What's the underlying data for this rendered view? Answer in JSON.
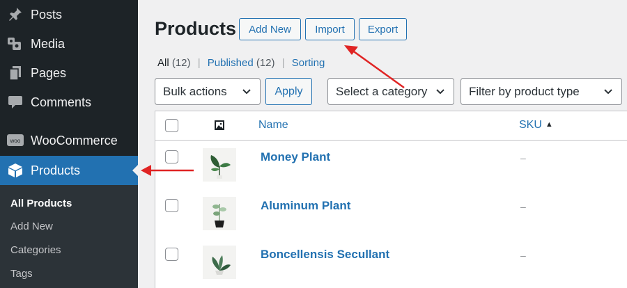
{
  "sidebar": {
    "items": [
      {
        "label": "Posts",
        "icon": "pushpin-icon"
      },
      {
        "label": "Media",
        "icon": "media-icon"
      },
      {
        "label": "Pages",
        "icon": "pages-icon"
      },
      {
        "label": "Comments",
        "icon": "comment-icon"
      },
      {
        "label": "WooCommerce",
        "icon": "woocommerce-icon",
        "icon_text": "woo"
      },
      {
        "label": "Products",
        "icon": "box-icon",
        "active": true
      }
    ],
    "submenu": [
      "All Products",
      "Add New",
      "Categories",
      "Tags"
    ],
    "accent": "#2271b1"
  },
  "header": {
    "title": "Products",
    "buttons": [
      "Add New",
      "Import",
      "Export"
    ]
  },
  "views": {
    "all_label": "All",
    "all_count": "(12)",
    "published_label": "Published",
    "published_count": "(12)",
    "sorting_label": "Sorting",
    "separator": "|"
  },
  "filters": {
    "bulk_actions": "Bulk actions",
    "apply": "Apply",
    "category": "Select a category",
    "product_type": "Filter by product type"
  },
  "table": {
    "columns": {
      "image": "image-icon",
      "name": "Name",
      "sku": "SKU"
    },
    "rows": [
      {
        "name": "Money Plant",
        "sku": "–"
      },
      {
        "name": "Aluminum Plant",
        "sku": "–"
      },
      {
        "name": "Boncellensis Secullant",
        "sku": "–"
      }
    ]
  },
  "annotation_color": "#e02424"
}
